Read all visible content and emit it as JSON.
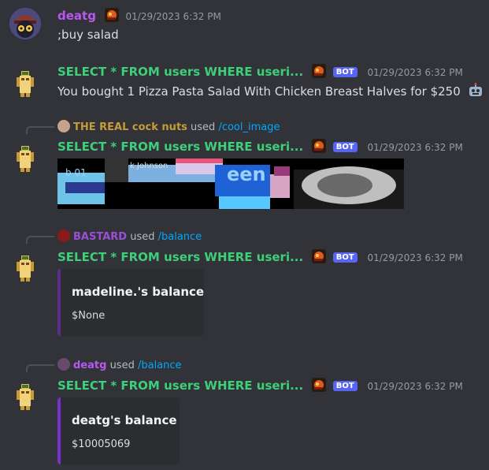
{
  "messages": [
    {
      "author": "deatg",
      "author_color": "#b759ef",
      "timestamp": "01/29/2023 6:32 PM",
      "content": ";buy salad"
    },
    {
      "author": "SELECT * FROM users WHERE useri...",
      "author_color": "#3ecf7a",
      "badge": "BOT",
      "timestamp": "01/29/2023 6:32 PM",
      "content": "You bought 1 Pizza Pasta Salad With Chicken Breast Halves for $250",
      "content_emoji": "robot-face-icon"
    },
    {
      "reply_user": "THE REAL cock nuts",
      "reply_user_color": "#c69c39",
      "reply_used": "used",
      "reply_command": "/cool_image",
      "author": "SELECT * FROM users WHERE useri...",
      "author_color": "#3ecf7a",
      "badge": "BOT",
      "timestamp": "01/29/2023 6:32 PM",
      "image_text": "k Johnson"
    },
    {
      "reply_user": "BASTARD",
      "reply_user_color": "#9a4fd6",
      "reply_used": "used",
      "reply_command": "/balance",
      "author": "SELECT * FROM users WHERE useri...",
      "author_color": "#3ecf7a",
      "badge": "BOT",
      "timestamp": "01/29/2023 6:32 PM",
      "embed_title": "madeline.'s balance",
      "embed_value": "$None",
      "embed_color": "#5a2c8f"
    },
    {
      "reply_user": "deatg",
      "reply_user_color": "#b759ef",
      "reply_used": "used",
      "reply_command": "/balance",
      "author": "SELECT * FROM users WHERE useri...",
      "author_color": "#3ecf7a",
      "badge": "BOT",
      "timestamp": "01/29/2023 6:32 PM",
      "embed_title": "deatg's balance",
      "embed_value": "$10005069",
      "embed_color": "#7a2fd0"
    }
  ],
  "colors": {
    "background": "#313338",
    "command_link": "#00a8fc",
    "bot_badge": "#5865f2"
  }
}
